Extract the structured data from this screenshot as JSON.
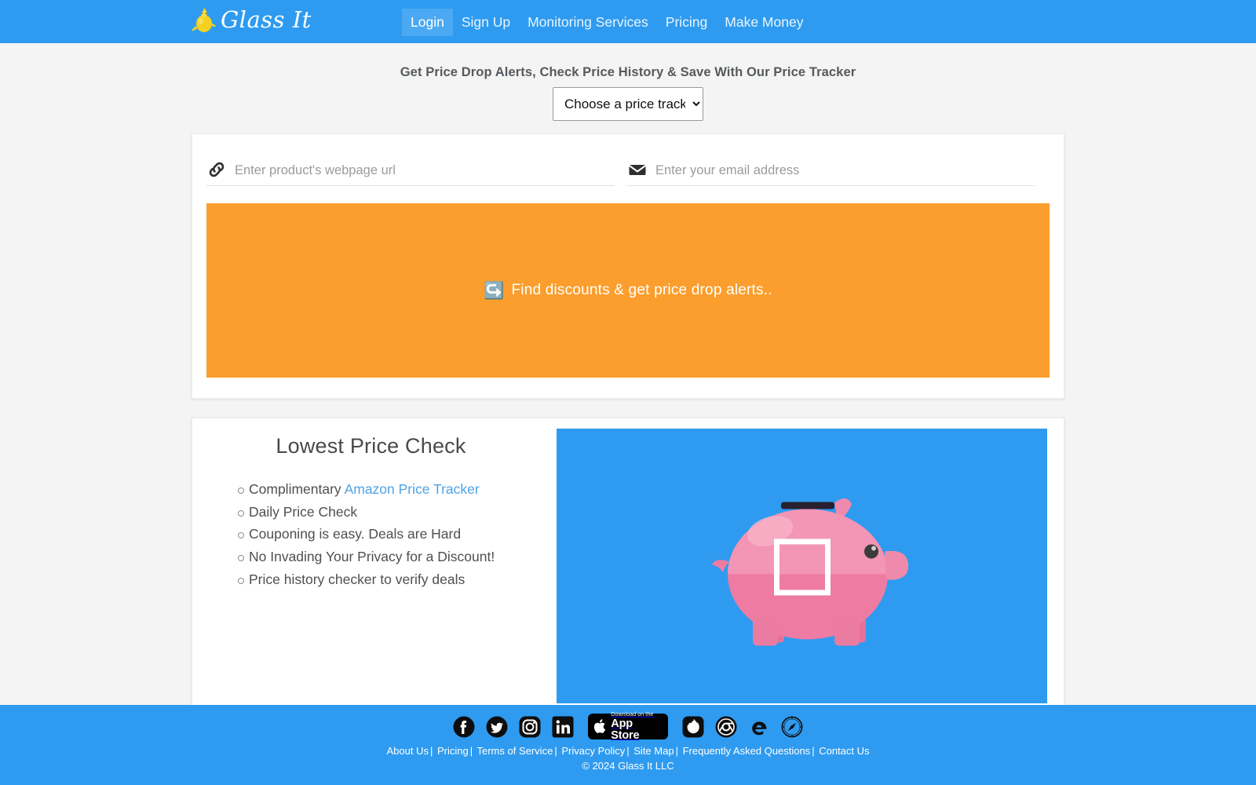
{
  "colors": {
    "brand_blue": "#2e9bf0",
    "nav_active": "#4aa9f2",
    "promo_orange": "#fb9e2d",
    "link_blue": "#4fa3e3",
    "page_bg": "#f4f4f4",
    "piggy_pink": "#ef7ba0"
  },
  "navbar": {
    "brand_label": "Glass It",
    "logo_icon": "genie-lamp-icon",
    "links": [
      {
        "label": "Login",
        "active": true
      },
      {
        "label": "Sign Up",
        "active": false
      },
      {
        "label": "Monitoring Services",
        "active": false
      },
      {
        "label": "Pricing",
        "active": false
      },
      {
        "label": "Make Money",
        "active": false
      }
    ]
  },
  "hero": {
    "headline": "Get Price Drop Alerts, Check Price History & Save With Our Price Tracker",
    "tracker_select": {
      "selected": "Choose a price tracker",
      "options": [
        "Choose a price tracker"
      ]
    }
  },
  "form_card": {
    "url_field": {
      "icon": "link-icon",
      "placeholder": "Enter product's webpage url",
      "value": ""
    },
    "email_field": {
      "icon": "envelope-icon",
      "placeholder": "Enter your email address",
      "value": ""
    },
    "promo": {
      "emoji": "↪️",
      "text": "Find discounts & get price drop alerts.."
    }
  },
  "feature_card": {
    "title": "Lowest Price Check",
    "items": [
      {
        "text": "Complimentary ",
        "link": "Amazon Price Tracker"
      },
      {
        "text": "Daily Price Check",
        "link": ""
      },
      {
        "text": "Couponing is easy. Deals are Hard",
        "link": ""
      },
      {
        "text": "No Invading Your Privacy for a Discount!",
        "link": ""
      },
      {
        "text": "Price history checker to verify deals",
        "link": ""
      }
    ],
    "image_alt": "piggy-bank-illustration"
  },
  "footer": {
    "social_icons": [
      "facebook-icon",
      "twitter-icon",
      "instagram-icon",
      "linkedin-icon"
    ],
    "appstore": {
      "sub_label": "Download on the",
      "main_label": "App Store",
      "icon": "apple-icon"
    },
    "browser_icons": [
      "firefox-icon",
      "chrome-icon",
      "edge-icon",
      "safari-icon"
    ],
    "links": [
      "About Us",
      "Pricing",
      "Terms of Service",
      "Privacy Policy",
      "Site Map",
      "Frequently Asked Questions",
      "Contact Us"
    ],
    "separator": "|",
    "copyright": "© 2024 Glass It LLC"
  }
}
